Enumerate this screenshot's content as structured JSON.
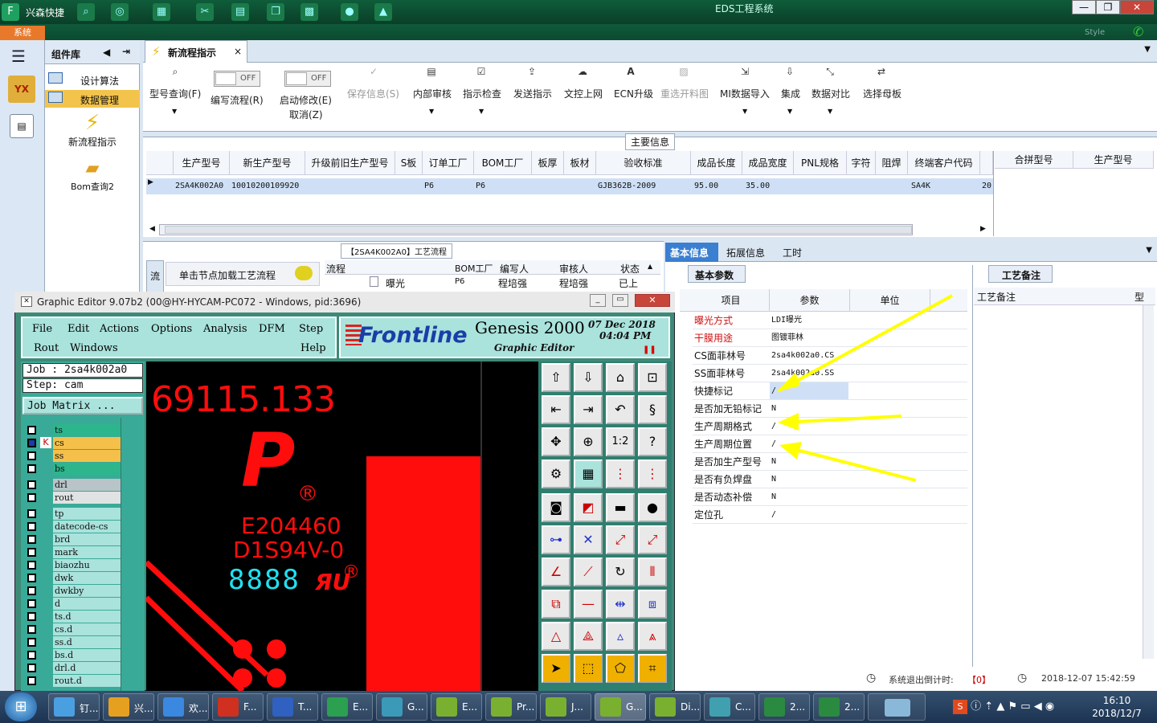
{
  "app": {
    "title": "EDS工程系统",
    "brand": "兴森快捷",
    "style_label": "Style"
  },
  "window_controls": {
    "minimize": "—",
    "maximize": "❐",
    "close": "✕"
  },
  "system_tab": "系统",
  "nav": {
    "title": "组件库",
    "items": [
      {
        "label": "设计算法"
      },
      {
        "label": "数据管理"
      }
    ],
    "launchers": [
      {
        "label": "新流程指示"
      },
      {
        "label": "Bom查询2"
      }
    ]
  },
  "doc_tab": {
    "label": "新流程指示",
    "close": "×"
  },
  "ribbon": {
    "buttons": [
      {
        "label": "型号查询(F)",
        "icon": "search-icon"
      },
      {
        "label": "编写流程(R)",
        "toggle": "OFF"
      },
      {
        "label": "启动修改(E)",
        "label2": "取消(Z)",
        "toggle": "OFF"
      },
      {
        "label": "保存信息(S)",
        "disabled": true
      },
      {
        "label": "内部审核"
      },
      {
        "label": "指示检查"
      },
      {
        "label": "发送指示"
      },
      {
        "label": "文控上网"
      },
      {
        "label": "ECN升级"
      },
      {
        "label": "重选开料图",
        "disabled": true
      },
      {
        "label": "MI数据导入"
      },
      {
        "label": "集成"
      },
      {
        "label": "数据对比"
      },
      {
        "label": "选择母板"
      }
    ]
  },
  "main_info": {
    "legend": "主要信息",
    "columns": [
      "生产型号",
      "新生产型号",
      "升级前旧生产型号",
      "S板",
      "订单工厂",
      "BOM工厂",
      "板厚",
      "板材",
      "验收标准",
      "成品长度",
      "成品宽度",
      "PNL规格",
      "字符",
      "阻焊",
      "终端客户代码"
    ],
    "row": [
      "2SA4K002A0",
      "10010200109920",
      "",
      "",
      "P6",
      "P6",
      "",
      "",
      "GJB362B-2009",
      "95.00",
      "35.00",
      "",
      "",
      "",
      "SA4K"
    ],
    "row_tail": "20",
    "side_columns": [
      "合拼型号",
      "生产型号"
    ]
  },
  "process": {
    "legend": "【2SA4K002A0】工艺流程",
    "side_tab": "流",
    "hint": "单击节点加载工艺流程",
    "columns": [
      "流程",
      "BOM工厂",
      "编写人",
      "审核人",
      "状态"
    ],
    "row": [
      "曝光",
      "P6",
      "程培强",
      "程培强",
      "已上"
    ]
  },
  "right": {
    "tabs": [
      "基本信息",
      "拓展信息",
      "工时"
    ],
    "subtab": "基本参数",
    "columns": [
      "项目",
      "参数",
      "单位"
    ],
    "rows": [
      {
        "label": "曝光方式",
        "value": "LDI曝光",
        "red": true
      },
      {
        "label": "干膜用途",
        "value": "图镀菲林",
        "red": true
      },
      {
        "label": "CS面菲林号",
        "value": "2sa4k002a0.CS"
      },
      {
        "label": "SS面菲林号",
        "value": "2sa4k002a0.SS"
      },
      {
        "label": "快捷标记",
        "value": "/"
      },
      {
        "label": "是否加无铅标记",
        "value": "N"
      },
      {
        "label": "生产周期格式",
        "value": "/"
      },
      {
        "label": "生产周期位置",
        "value": "/"
      },
      {
        "label": "是否加生产型号",
        "value": "N"
      },
      {
        "label": "是否有负焊盘",
        "value": "N"
      },
      {
        "label": "是否动态补偿",
        "value": "N"
      },
      {
        "label": "定位孔",
        "value": "/"
      }
    ],
    "remark_tab": "工艺备注",
    "remark_col": "工艺备注",
    "remark_col2": "型"
  },
  "status": {
    "countdown_label": "系统退出倒计时:",
    "countdown_value": "【0】",
    "datetime": "2018-12-07 15:42:59"
  },
  "graphic_editor": {
    "title": "Graphic Editor 9.07b2 (00@HY-HYCAM-PC072 - Windows, pid:3696)",
    "menu": [
      "File",
      "Edit",
      "Actions",
      "Options",
      "Analysis",
      "DFM",
      "Step",
      "Rout",
      "Windows",
      "Help"
    ],
    "logo": "Frontline",
    "product": "Genesis 2000",
    "subtitle": "Graphic Editor",
    "date": "07 Dec 2018",
    "time": "04:04 PM",
    "job": "Job  : 2sa4k002a0",
    "step": "Step: cam",
    "job_matrix": "Job Matrix ...",
    "layers": [
      {
        "name": "ts",
        "color": "#2db58c"
      },
      {
        "name": "cs",
        "color": "#f4c04a"
      },
      {
        "name": "ss",
        "color": "#f4c04a"
      },
      {
        "name": "bs",
        "color": "#2db58c"
      },
      {
        "name": "drl",
        "color": "#b8c4c8"
      },
      {
        "name": "rout",
        "color": "#dfe3e3"
      },
      {
        "name": "tp",
        "color": "#a9e3dc"
      },
      {
        "name": "datecode-cs",
        "color": "#a9e3dc"
      },
      {
        "name": "brd",
        "color": "#a9e3dc"
      },
      {
        "name": "mark",
        "color": "#a9e3dc"
      },
      {
        "name": "biaozhu",
        "color": "#a9e3dc"
      },
      {
        "name": "dwk",
        "color": "#a9e3dc"
      },
      {
        "name": "dwkby",
        "color": "#a9e3dc"
      },
      {
        "name": "d",
        "color": "#a9e3dc"
      },
      {
        "name": "ts.d",
        "color": "#a9e3dc"
      },
      {
        "name": "cs.d",
        "color": "#a9e3dc"
      },
      {
        "name": "ss.d",
        "color": "#a9e3dc"
      },
      {
        "name": "bs.d",
        "color": "#a9e3dc"
      },
      {
        "name": "drl.d",
        "color": "#a9e3dc"
      },
      {
        "name": "rout.d",
        "color": "#a9e3dc"
      }
    ],
    "canvas": {
      "coord": "69115.133",
      "ul": "E204460",
      "rating": "D1S94V-0",
      "date_digits": "8888",
      "logo_letter": "P",
      "reg": "®"
    }
  },
  "taskbar": {
    "tasks": [
      "钉...",
      "兴...",
      "欢...",
      "F...",
      "T...",
      "E...",
      "G...",
      "E...",
      "Pr...",
      "J...",
      "G...",
      "Di...",
      "C...",
      "2...",
      "2..."
    ],
    "time": "16:10",
    "date": "2018/12/7"
  },
  "colors": {
    "accent": "#e8792a",
    "pcb_red": "#ff0d0d",
    "canvas": "#000000",
    "annotation": "#ffff00"
  }
}
